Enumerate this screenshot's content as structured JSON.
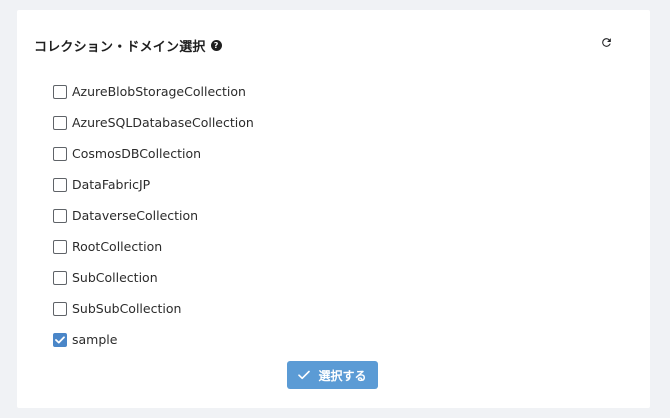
{
  "panel": {
    "title": "コレクション・ドメイン選択",
    "help_icon": "question-circle-icon",
    "help_glyph": "?",
    "refresh_icon": "refresh-icon"
  },
  "collections": [
    {
      "label": "AzureBlobStorageCollection",
      "checked": false
    },
    {
      "label": "AzureSQLDatabaseCollection",
      "checked": false
    },
    {
      "label": "CosmosDBCollection",
      "checked": false
    },
    {
      "label": "DataFabricJP",
      "checked": false
    },
    {
      "label": "DataverseCollection",
      "checked": false
    },
    {
      "label": "RootCollection",
      "checked": false
    },
    {
      "label": "SubCollection",
      "checked": false
    },
    {
      "label": "SubSubCollection",
      "checked": false
    },
    {
      "label": "sample",
      "checked": true
    }
  ],
  "actions": {
    "select_label": "選択する",
    "select_icon": "check-icon"
  },
  "colors": {
    "accent": "#5b9bd5",
    "checkbox_checked": "#4a86c8",
    "background": "#f0f2f5",
    "panel": "#ffffff"
  }
}
